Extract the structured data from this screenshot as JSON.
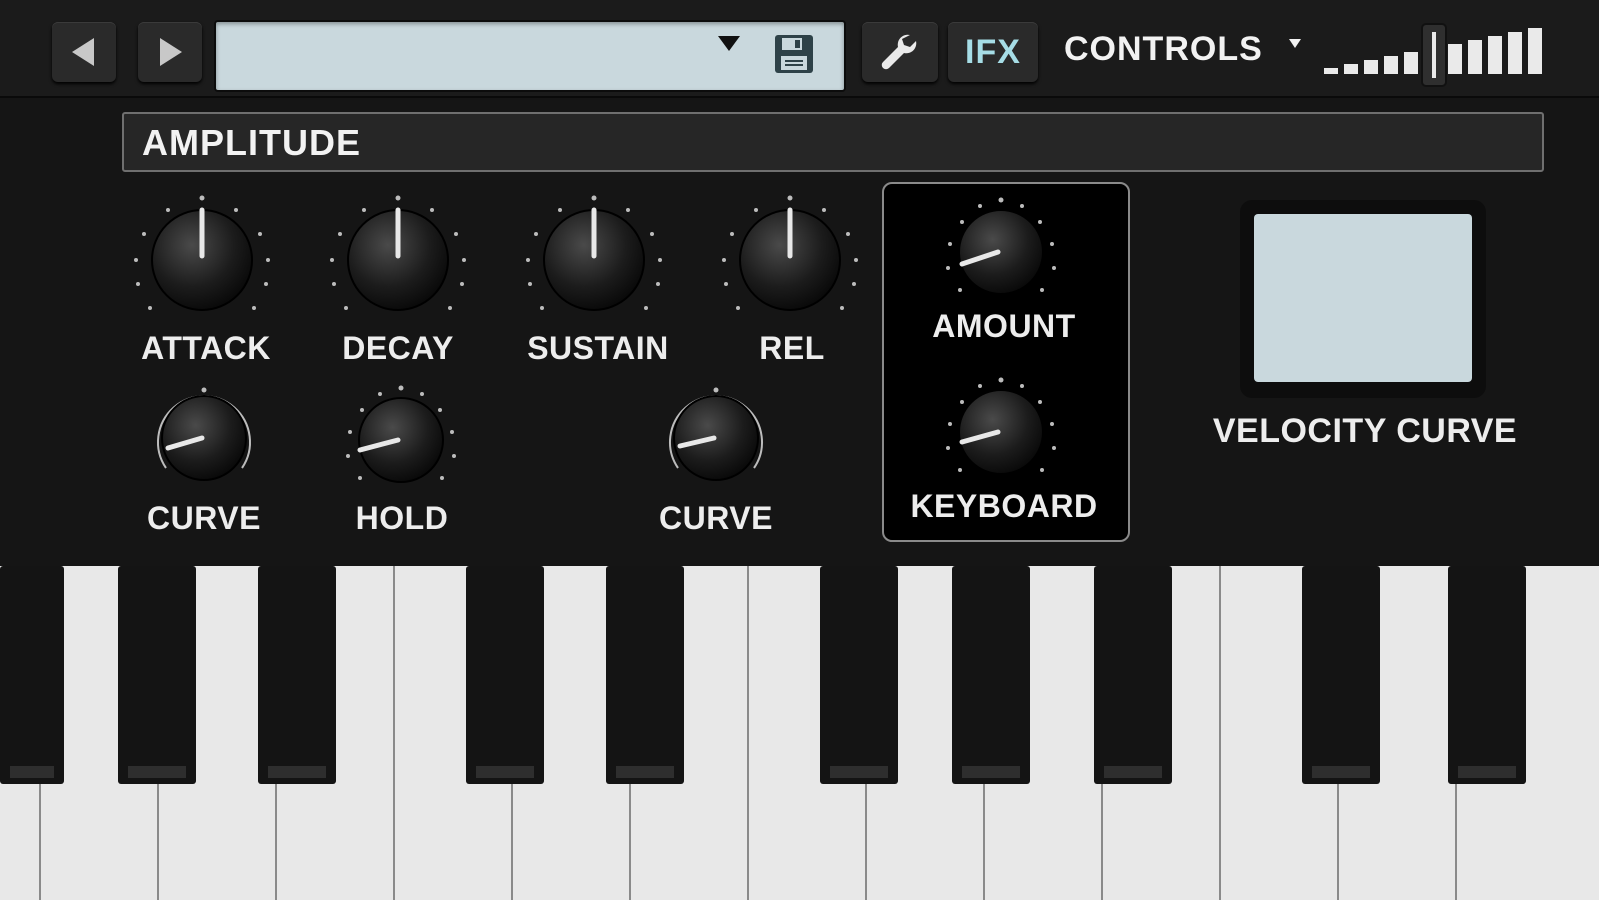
{
  "header": {
    "nav_prev": "previous-preset",
    "nav_next": "next-preset",
    "preset_name": "",
    "ifx_label": "IFX",
    "controls_label": "CONTROLS",
    "volume_level_fraction": 0.5
  },
  "section": {
    "title": "AMPLITUDE"
  },
  "knobs": {
    "attack": {
      "label": "ATTACK"
    },
    "decay": {
      "label": "DECAY"
    },
    "sustain": {
      "label": "SUSTAIN"
    },
    "release": {
      "label": "REL"
    },
    "attack_curve": {
      "label": "CURVE"
    },
    "hold": {
      "label": "HOLD"
    },
    "release_curve": {
      "label": "CURVE"
    },
    "amount": {
      "label": "AMOUNT"
    },
    "keyboard": {
      "label": "KEYBOARD"
    }
  },
  "velocity": {
    "label": "VELOCITY CURVE"
  },
  "colors": {
    "accent": "#a6dde6",
    "display": "#c9d8dd",
    "panel": "#151515"
  }
}
